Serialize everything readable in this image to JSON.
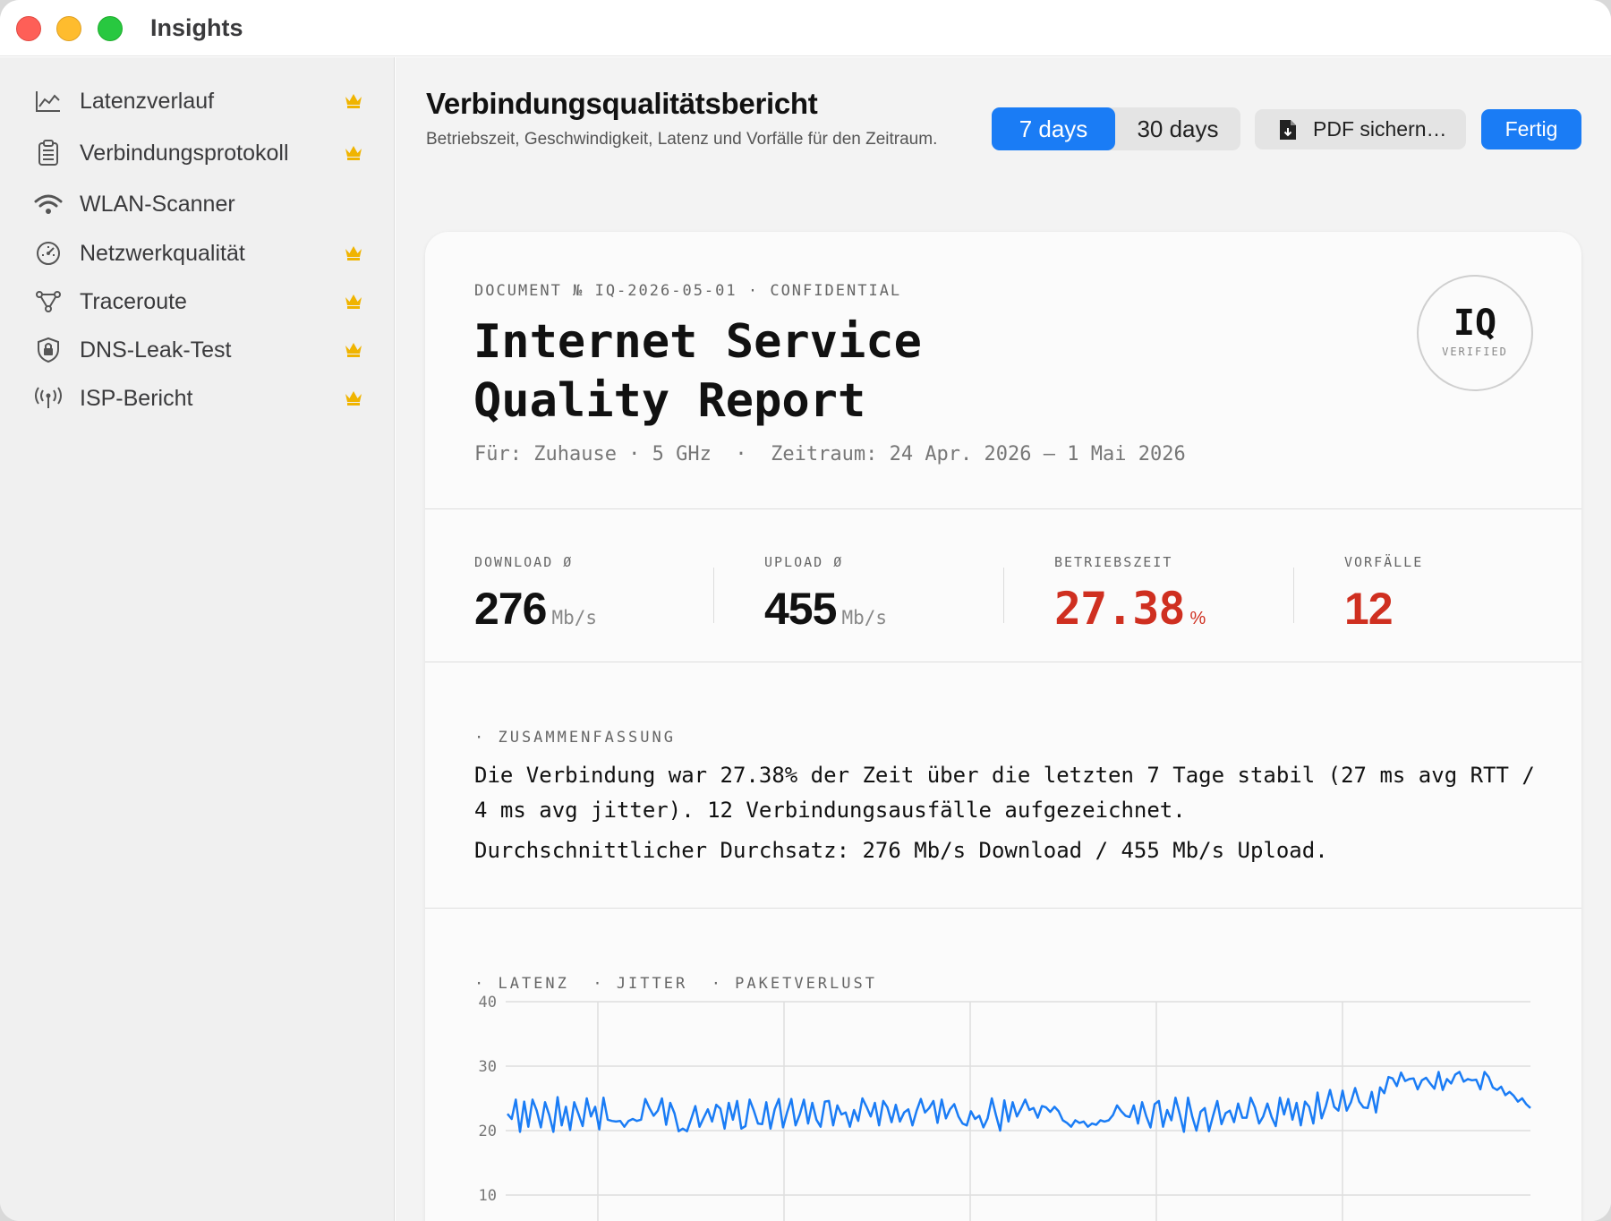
{
  "window": {
    "title": "Insights"
  },
  "sidebar": {
    "items": [
      {
        "label": "Latenzverlauf",
        "icon": "line-chart-icon",
        "premium": true
      },
      {
        "label": "Verbindungsprotokoll",
        "icon": "clipboard-icon",
        "premium": true
      },
      {
        "label": "WLAN-Scanner",
        "icon": "wifi-icon",
        "premium": false
      },
      {
        "label": "Netzwerkqualität",
        "icon": "gauge-icon",
        "premium": true
      },
      {
        "label": "Traceroute",
        "icon": "nodes-icon",
        "premium": true
      },
      {
        "label": "DNS-Leak-Test",
        "icon": "shield-lock-icon",
        "premium": true
      },
      {
        "label": "ISP-Bericht",
        "icon": "antenna-icon",
        "premium": true
      }
    ],
    "premium_color": "#f0b400"
  },
  "header": {
    "title": "Verbindungsqualitätsbericht",
    "subtitle": "Betriebszeit, Geschwindigkeit, Latenz und Vorfälle für den Zeitraum.",
    "range_tabs": [
      {
        "label": "7 days",
        "selected": true
      },
      {
        "label": "30 days",
        "selected": false
      }
    ],
    "pdf_button": "PDF sichern…",
    "done_button": "Fertig",
    "accent": "#1a7cf5"
  },
  "report": {
    "doc_number": "DOCUMENT № IQ-2026-05-01 · CONFIDENTIAL",
    "title": "Internet Service Quality Report",
    "meta": "Für: Zuhause · 5 GHz  ·  Zeitraum: 24 Apr. 2026 – 1 Mai 2026",
    "seal": {
      "main": "IQ",
      "sub": "VERIFIED"
    },
    "metrics": [
      {
        "label": "DOWNLOAD Ø",
        "value": "276",
        "unit": "Mb/s",
        "alert": false
      },
      {
        "label": "UPLOAD Ø",
        "value": "455",
        "unit": "Mb/s",
        "alert": false
      },
      {
        "label": "BETRIEBSZEIT",
        "value": "27.38",
        "unit": "%",
        "alert": true
      },
      {
        "label": "VORFÄLLE",
        "value": "12",
        "unit": "",
        "alert": true
      }
    ],
    "alert_color": "#cf2f20",
    "summary_label": "· ZUSAMMENFASSUNG",
    "summary": [
      "Die Verbindung war 27.38% der Zeit über die letzten 7 Tage stabil (27 ms avg RTT / 4 ms avg jitter). 12 Verbindungsausfälle aufgezeichnet.",
      "Durchschnittlicher Durchsatz: 276 Mb/s Download / 455 Mb/s Upload."
    ],
    "chart_label": "· LATENZ  · JITTER  · PAKETVERLUST"
  },
  "chart_data": {
    "type": "line",
    "title": "",
    "xlabel": "",
    "ylabel": "",
    "yticks": [
      40,
      30,
      20,
      10
    ],
    "ylim": [
      10,
      40
    ],
    "grid": true,
    "line_color": "#1a7cf5",
    "series": [
      {
        "values": [
          22.6,
          21.8,
          24.8,
          19.8,
          24.5,
          20.6,
          24.8,
          23.1,
          20.5,
          24.4,
          22.4,
          19.8,
          25.2,
          20.8,
          23.7,
          20.1,
          24.4,
          22.6,
          20.7,
          25.0,
          22.2,
          23.7,
          20.2,
          25.1,
          21.7,
          21.5,
          21.4,
          21.5,
          20.6,
          21.5,
          21.8,
          21.5,
          21.7,
          24.9,
          23.5,
          22.3,
          23.1,
          25.0,
          20.9,
          24.3,
          22.7,
          19.9,
          20.3,
          19.9,
          21.8,
          23.8,
          20.6,
          22.0,
          23.3,
          21.4,
          24.0,
          23.4,
          20.3,
          24.3,
          21.7,
          24.6,
          20.3,
          20.7,
          24.8,
          23.1,
          21.1,
          21.0,
          24.4,
          20.3,
          23.3,
          24.9,
          20.5,
          22.9,
          24.9,
          20.8,
          22.5,
          24.8,
          21.1,
          24.3,
          21.7,
          20.6,
          24.5,
          24.6,
          20.8,
          23.9,
          22.5,
          22.8,
          20.6,
          23.2,
          21.5,
          25.0,
          23.7,
          22.2,
          24.3,
          20.8,
          24.6,
          23.6,
          21.3,
          24.0,
          21.4,
          22.8,
          23.3,
          20.8,
          23.1,
          24.9,
          22.8,
          23.5,
          24.6,
          21.2,
          24.8,
          21.9,
          23.3,
          24.1,
          22.2,
          21.1,
          20.8,
          23.0,
          21.8,
          22.3,
          20.5,
          21.9,
          25.0,
          22.4,
          20.0,
          24.7,
          21.4,
          24.4,
          22.2,
          23.4,
          24.8,
          23.2,
          23.5,
          22.0,
          23.8,
          23.6,
          22.9,
          23.7,
          23.0,
          21.6,
          21.2,
          20.6,
          21.6,
          21.2,
          21.4,
          20.6,
          21.1,
          20.9,
          21.6,
          21.4,
          21.6,
          22.4,
          23.9,
          23.0,
          22.3,
          22.1,
          23.9,
          21.1,
          24.4,
          22.2,
          20.5,
          24.1,
          24.6,
          20.6,
          23.2,
          21.6,
          25.1,
          22.6,
          19.8,
          25.1,
          22.2,
          20.0,
          22.9,
          23.5,
          19.9,
          22.3,
          24.6,
          21.0,
          22.7,
          23.1,
          21.3,
          24.2,
          22.0,
          22.0,
          25.1,
          23.6,
          21.1,
          22.2,
          24.2,
          22.1,
          20.7,
          25.1,
          22.5,
          24.9,
          21.7,
          24.3,
          20.8,
          24.5,
          23.7,
          21.1,
          25.9,
          21.9,
          23.8,
          26.3,
          23.7,
          23.1,
          26.2,
          23.1,
          24.4,
          26.6,
          24.5,
          23.6,
          23.5,
          26.0,
          22.8,
          26.7,
          25.8,
          28.3,
          28.1,
          26.9,
          29.0,
          27.7,
          28.0,
          28.1,
          26.4,
          27.8,
          28.2,
          27.3,
          26.5,
          29.1,
          26.3,
          28.0,
          27.3,
          28.7,
          29.1,
          27.6,
          28.0,
          27.8,
          27.9,
          26.4,
          29.1,
          28.3,
          26.7,
          26.3,
          26.8,
          25.5,
          26.0,
          25.4,
          24.5,
          25.0,
          24.1,
          23.5
        ]
      }
    ]
  }
}
